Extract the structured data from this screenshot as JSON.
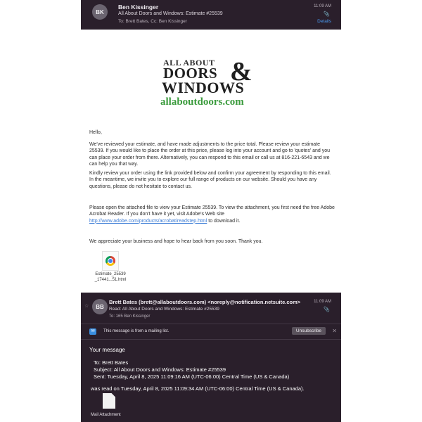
{
  "email1": {
    "sender_initials": "BK",
    "sender_name": "Ben Kissinger",
    "subject": "All About Doors and Windows: Estimate #25539",
    "to_line": "To:  Brett Bates,   Cc:  Ben Kissinger",
    "time": "11:09 AM",
    "details_label": "Details",
    "logo": {
      "line1": "ALL ABOUT",
      "line2": "DOORS",
      "amp": "&",
      "line3": "WINDOWS",
      "domain": "allaboutdoors.com"
    },
    "greeting": "Hello,",
    "para1": "We've reviewed your estimate, and have made adjustments to the price total. Please review your estimate 25539. If you would like to place the order at this price, please log into your account and go to 'quotes' and you can place your order from there. Alternatively, you can respond to this email or call us at 816-221-6543 and we can help you that way.",
    "para2": "Kindly review your order using the link provided below and confirm your agreement by responding to this email. In the meantime, we invite you to explore our full range of products on our website. Should you have any questions, please do not hesitate to contact us.",
    "para3_pre": "Please open the attached file to view your Estimate 25539. To view the attachment, you first need the free Adobe Acrobat Reader. If you don't have it yet, visit Adobe's Web site",
    "para3_link": "http://www.adobe.com/products/acrobat/readstep.html",
    "para3_post": " to download it.",
    "closing": "We appreciate your business and hope to hear back from you soon. Thank you.",
    "attachment_line1": "Estimate_25539",
    "attachment_line2": "_17441...51.html"
  },
  "email2": {
    "sender_initials": "BB",
    "from_line": "Brett Bates (brett@allaboutdoors.com) <noreply@notification.netsuite.com>",
    "read_line": "Read: All About Doors and Windows: Estimate #25539",
    "to_line": "To:  165 Ben Kissinger",
    "time": "11:09 AM",
    "mailing_list_text": "This message is from a mailing list.",
    "unsubscribe_label": "Unsubscribe",
    "your_message": "Your message",
    "rm_to": "To: Brett Bates",
    "rm_subject": "Subject: All About Doors and Windows: Estimate #25539",
    "rm_sent": "Sent: Tuesday, April 8, 2025 11:09:16 AM (UTC-06:00) Central Time (US & Canada)",
    "rm_was_read": "was read on Tuesday, April 8, 2025 11:09:34 AM (UTC-06:00) Central Time (US & Canada).",
    "attachment_name": "Mail Attachment"
  },
  "icons": {
    "clip": "paperclip-icon",
    "star": "star-icon",
    "close": "close-icon"
  },
  "colors": {
    "header_bg": "#2a1f2b",
    "link": "#3a7bd5",
    "logo_green": "#3a9b3c",
    "details_blue": "#4a9bf2"
  }
}
